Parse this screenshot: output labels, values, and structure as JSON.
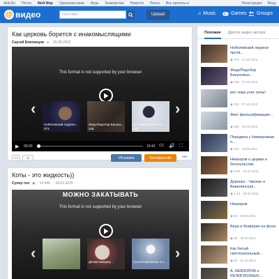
{
  "portal": {
    "links": [
      "Mail.Ru",
      "Почта",
      "Мой Мир",
      "Одноклассники",
      "Игры",
      "Знакомства",
      "Новости",
      "Поиск",
      "Все проекты ▾"
    ],
    "active_index": 2,
    "right_links": [
      "Регистрация",
      "Вход"
    ]
  },
  "header": {
    "logo_text": "видео",
    "search_placeholder": "Find video",
    "upload_label": "Upload",
    "nav": [
      {
        "label": "Music",
        "icon": "music-note-icon"
      },
      {
        "label": "Games",
        "icon": "gamepad-icon"
      },
      {
        "label": "Groups",
        "icon": "groups-icon"
      }
    ]
  },
  "videos": [
    {
      "title": "Как церковь борется с инакомыслящими",
      "author": "Сергей Близнецов",
      "views": "",
      "date": "29.08.2012",
      "message": "This format is not supported by your browser",
      "thumbs": [
        {
          "caption": "Нобелевский лауреат...",
          "views": "373"
        },
        {
          "caption": "ЖидоПедоХор Бануха...",
          "views": "246"
        },
        {
          "caption": "вот чему учат полы!",
          "views": "102"
        }
      ],
      "time_current": "00:00",
      "time_duration": "19:42",
      "cc_label": "CC",
      "share_vk": "VKontakte",
      "share_ok": "Odnoklassniki"
    },
    {
      "title": "Коты - это жидкость))",
      "author": "Супер топ",
      "views": "14 449",
      "date": "04.03.2015",
      "message": "This format is not supported by your browser",
      "overlay_text": "МОЖНО ЗАКАТЫВАТЬ",
      "thumbs": [
        {
          "caption": "",
          "views": ""
        },
        {
          "caption": "Делаю вакцину...",
          "views": ""
        },
        {
          "caption": "Солнечный ветер и с...",
          "views": ""
        }
      ]
    }
  ],
  "sidebar": {
    "tabs": [
      "Похожие",
      "Другое видео автора"
    ],
    "active_tab": 0,
    "items": [
      {
        "title": "Нобелевский лауреат протв...",
        "views": "373",
        "date": "17.10.2012"
      },
      {
        "title": "ЖидоПедоХор Бануховых...",
        "views": "246",
        "date": "27.03.2012"
      },
      {
        "title": "вот чему учат попы!",
        "views": "102",
        "date": "07.12.2013"
      },
      {
        "title": "Факт фальсификацию...",
        "views": "526",
        "date": "03.01.2012"
      },
      {
        "title": "Передача с Невзоровым о...",
        "views": "421",
        "date": "18.08.2011"
      },
      {
        "title": "Невзоров о церкви и богохульстве",
        "views": "2.6K",
        "date": "15.07.2011"
      },
      {
        "title": "Доренко - Чаплин и Вавилинская...",
        "views": "1.4K",
        "date": "20.02.2011"
      },
      {
        "title": "Невзоров",
        "views": "84",
        "date": "20.03.2011"
      },
      {
        "title": "Вера и безверие на фоне",
        "views": "18",
        "date": "30.03.2014"
      },
      {
        "title": "Как битый светлоокольный...",
        "views": "61",
        "date": "11.03.2013"
      },
      {
        "title": "А. НЕВЗОРОВ о РЕЛИГИОЗНЫХ...",
        "views": "",
        "date": ""
      }
    ]
  }
}
